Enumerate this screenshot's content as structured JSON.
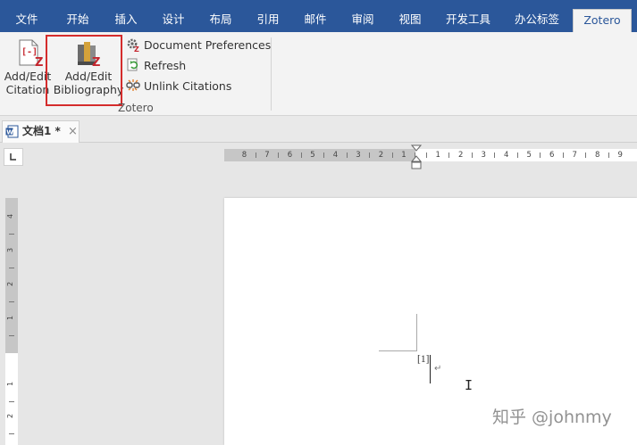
{
  "ribbon_tabs": [
    {
      "label": "文件",
      "active": false
    },
    {
      "label": "开始",
      "active": false
    },
    {
      "label": "插入",
      "active": false
    },
    {
      "label": "设计",
      "active": false
    },
    {
      "label": "布局",
      "active": false
    },
    {
      "label": "引用",
      "active": false
    },
    {
      "label": "邮件",
      "active": false
    },
    {
      "label": "审阅",
      "active": false
    },
    {
      "label": "视图",
      "active": false
    },
    {
      "label": "开发工具",
      "active": false
    },
    {
      "label": "办公标签",
      "active": false
    },
    {
      "label": "Zotero",
      "active": true
    }
  ],
  "zotero": {
    "citation_line1": "Add/Edit",
    "citation_line2": "Citation",
    "bibliography_line1": "Add/Edit",
    "bibliography_line2": "Bibliography",
    "doc_prefs": "Document Preferences",
    "refresh": "Refresh",
    "unlink": "Unlink Citations",
    "group_label": "Zotero"
  },
  "document": {
    "tab_name": "文档1 *",
    "close_glyph": "×",
    "citation_text": "[1]",
    "paragraph_mark": "↵",
    "ibeam": "I"
  },
  "ruler": {
    "left_numbers": [
      "8",
      "7",
      "6",
      "5",
      "4",
      "3",
      "2",
      "1"
    ],
    "right_numbers": [
      "1",
      "2",
      "3",
      "4",
      "5",
      "6",
      "7",
      "8",
      "9"
    ],
    "vertical_numbers": [
      "4",
      "3",
      "2",
      "1",
      "1",
      "2"
    ]
  },
  "watermark": "知乎 @johnmy",
  "colors": {
    "ribbon_blue": "#2b579a",
    "highlight_red": "#d42c2c",
    "zotero_red": "#c4262e"
  }
}
